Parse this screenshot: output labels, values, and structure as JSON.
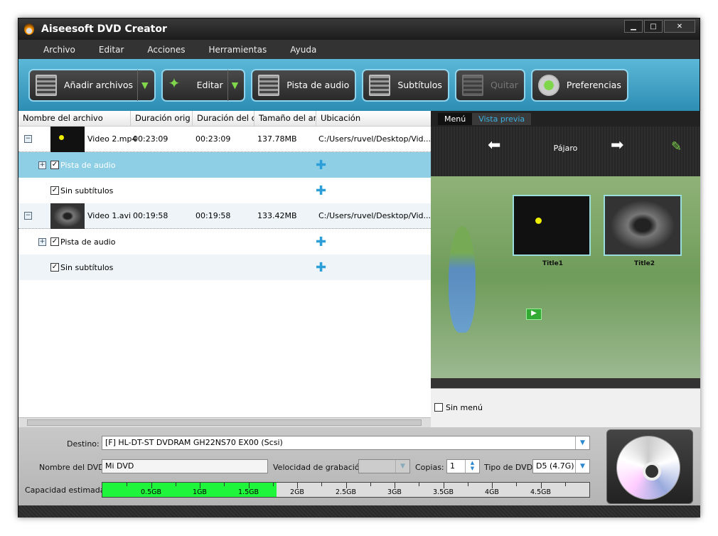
{
  "window": {
    "title": "Aiseesoft DVD Creator",
    "minimize": "▁",
    "maximize": "□",
    "close": "✕"
  },
  "menu": [
    "Archivo",
    "Editar",
    "Acciones",
    "Herramientas",
    "Ayuda"
  ],
  "toolbar": {
    "add": "Añadir archivos",
    "edit": "Editar",
    "audio": "Pista de audio",
    "subs": "Subtítulos",
    "remove": "Quitar",
    "prefs": "Preferencias"
  },
  "columns": [
    "Nombre del archivo",
    "Duración orig",
    "Duración del c",
    "Tamaño del ar",
    "Ubicación"
  ],
  "files": [
    {
      "name": "Video 2.mp4",
      "orig": "00:23:09",
      "dur": "00:23:09",
      "size": "137.78MB",
      "loc": "C:/Users/ruvel/Desktop/Vid...",
      "audio": "Pista de audio",
      "subs": "Sin subtítulos"
    },
    {
      "name": "Video 1.avi",
      "orig": "00:19:58",
      "dur": "00:19:58",
      "size": "133.42MB",
      "loc": "C:/Users/ruvel/Desktop/Vid...",
      "audio": "Pista de audio",
      "subs": "Sin subtítulos"
    }
  ],
  "preview": {
    "tab_menu": "Menú",
    "tab_preview": "Vista previa",
    "theme": "Pájaro",
    "titles": [
      "Title1",
      "Title2"
    ],
    "no_menu": "Sin menú"
  },
  "bottom": {
    "dest_label": "Destino:",
    "dest_value": "[F] HL-DT-ST DVDRAM GH22NS70 EX00 (Scsi)",
    "name_label": "Nombre del DVD:",
    "name_value": "Mi DVD",
    "speed_label": "Velocidad de grabación:",
    "speed_value": "",
    "copies_label": "Copias:",
    "copies_value": "1",
    "type_label": "Tipo de DVD:",
    "type_value": "D5 (4.7G)",
    "cap_label": "Capacidad estimada:",
    "cap_ticks": [
      "0.5GB",
      "1GB",
      "1.5GB",
      "2GB",
      "2.5GB",
      "3GB",
      "3.5GB",
      "4GB",
      "4.5GB"
    ],
    "cap_used_gb": 1.79,
    "cap_scale_gb": 5
  },
  "colors": {
    "accent": "#2d8db3",
    "selected_row": "#8ecfe6",
    "capacity_fill": "#1ff53a"
  }
}
